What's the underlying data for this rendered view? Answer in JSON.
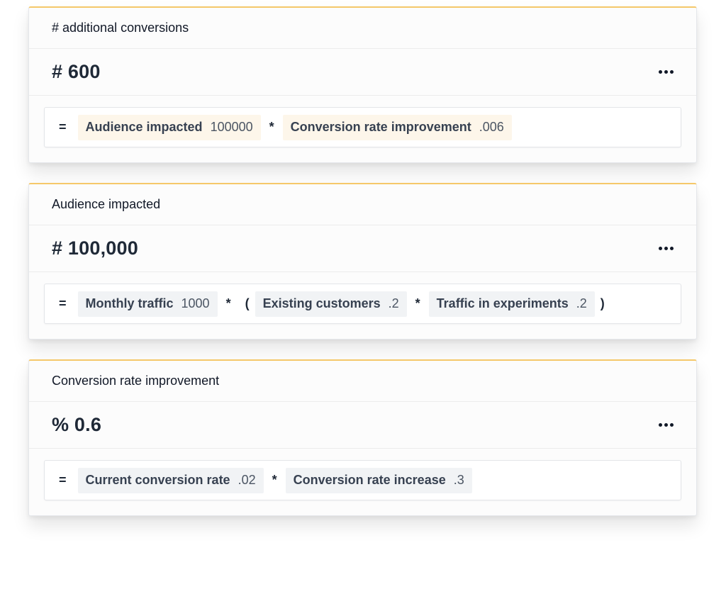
{
  "cards": [
    {
      "title": "# additional conversions",
      "value": "# 600",
      "formula": {
        "equals": "=",
        "chip1": {
          "label": "Audience impacted",
          "value": "100000"
        },
        "op1": "*",
        "chip2": {
          "label": "Conversion rate improvement",
          "value": ".006"
        }
      }
    },
    {
      "title": "Audience impacted",
      "value": "# 100,000",
      "formula": {
        "equals": "=",
        "chip1": {
          "label": "Monthly traffic",
          "value": "1000"
        },
        "op1": "*",
        "open_paren": "(",
        "chip2": {
          "label": "Existing customers",
          "value": ".2"
        },
        "op2": "*",
        "chip3": {
          "label": "Traffic in experiments",
          "value": ".2"
        },
        "close_paren": ")"
      }
    },
    {
      "title": "Conversion rate improvement",
      "value": "% 0.6",
      "formula": {
        "equals": "=",
        "chip1": {
          "label": "Current conversion rate",
          "value": ".02"
        },
        "op1": "*",
        "chip2": {
          "label": "Conversion rate increase",
          "value": ".3"
        }
      }
    }
  ],
  "icons": {
    "more": "more-horizontal-icon"
  },
  "colors": {
    "accent_border": "#f5c86a",
    "chip_warm": "#fdf6ea",
    "chip_cool": "#f1f3f5"
  }
}
